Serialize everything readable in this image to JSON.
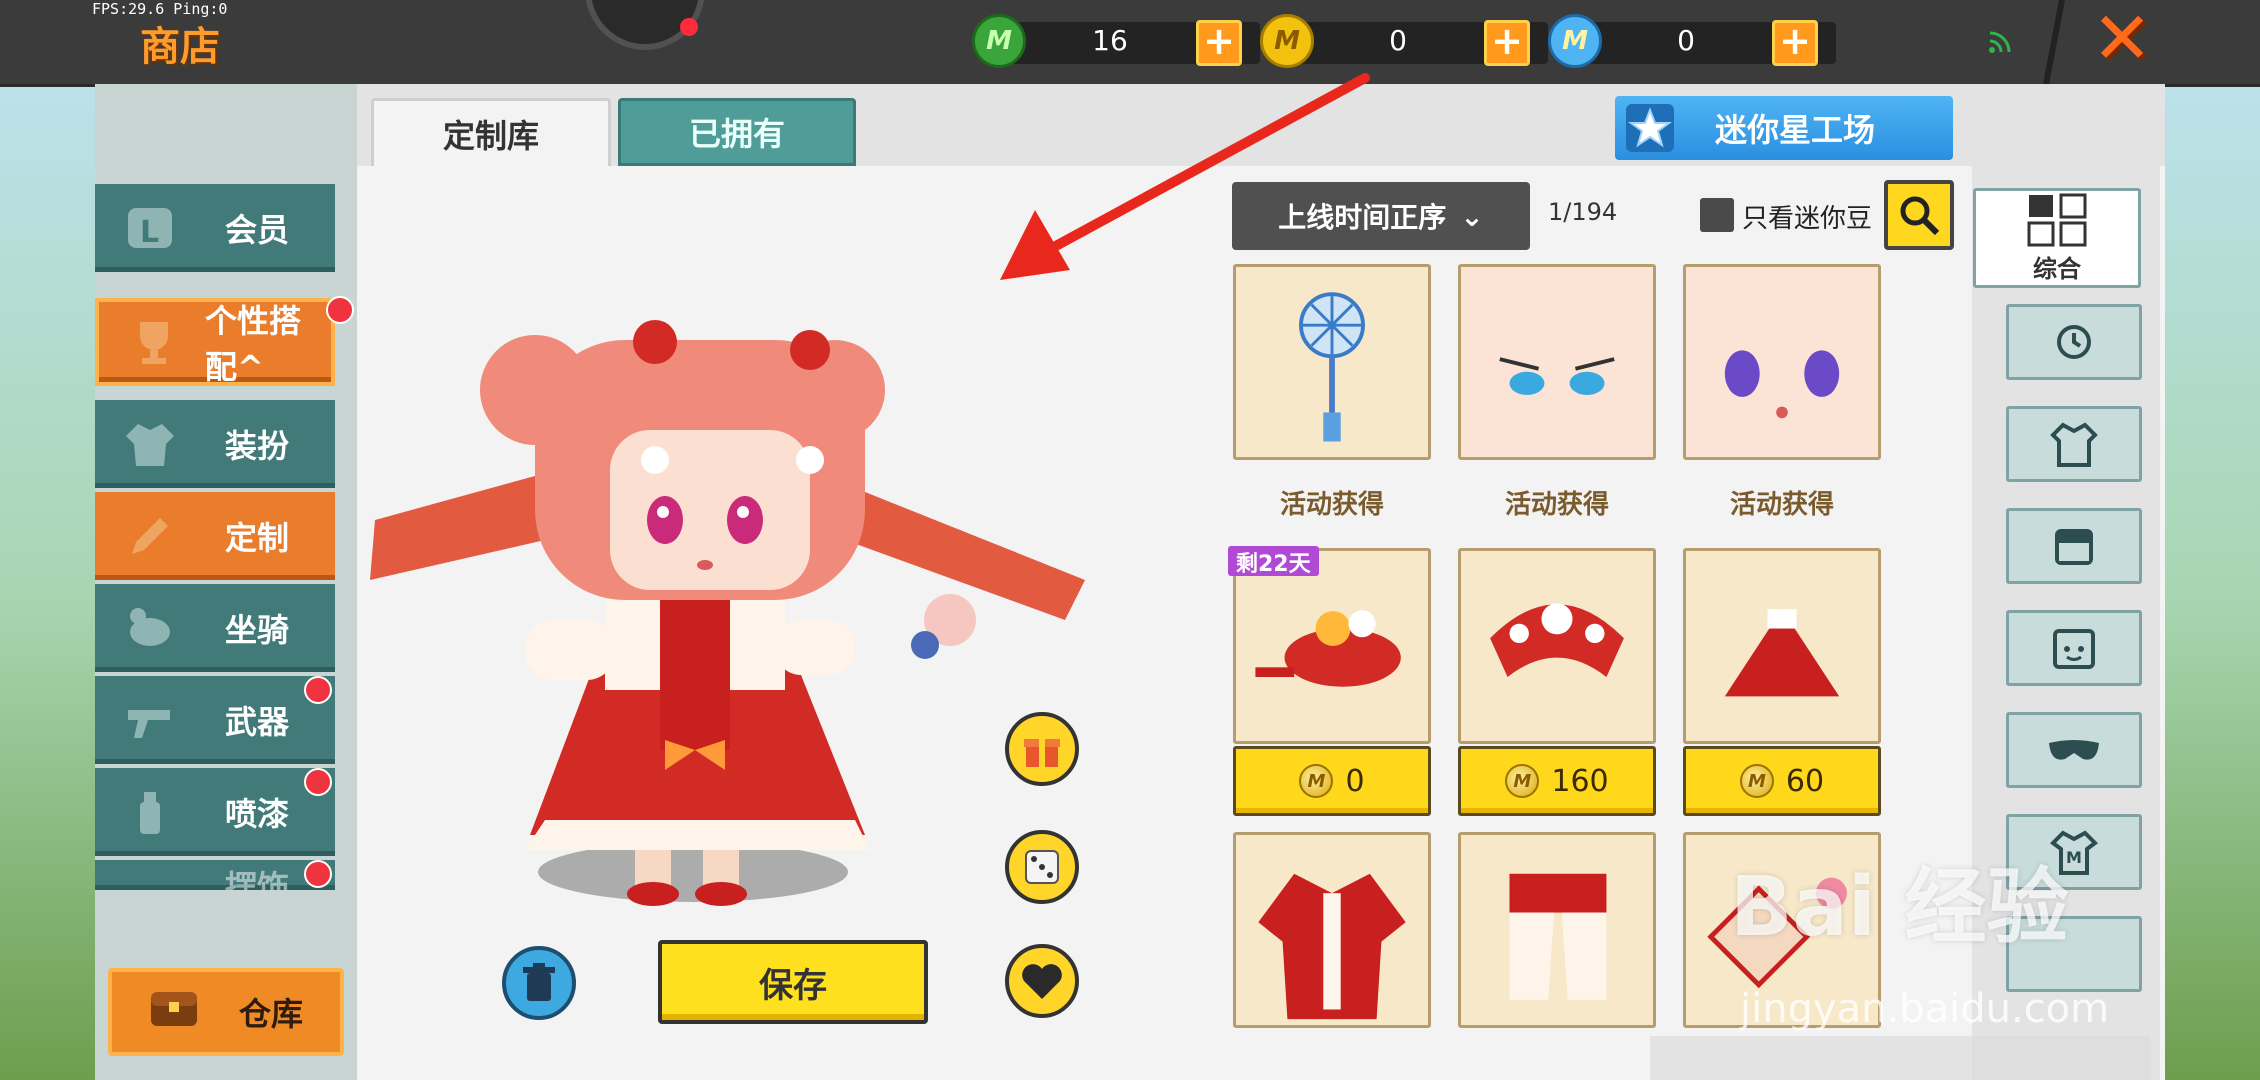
{
  "status": {
    "fps": "FPS:29.6  Ping:0"
  },
  "header": {
    "title": "商店",
    "currencies": [
      {
        "icon": "green-gem-icon",
        "value": "16"
      },
      {
        "icon": "gold-coin-icon",
        "value": "0"
      },
      {
        "icon": "blue-coin-icon",
        "value": "0"
      }
    ]
  },
  "tabs": [
    "定制库",
    "已拥有"
  ],
  "workshop_button": "迷你星工场",
  "sidebar": {
    "items": [
      {
        "label": "会员",
        "icon": "member-icon",
        "style": "teal",
        "dot": false
      },
      {
        "label": "个性搭配",
        "icon": "trophy-icon",
        "style": "orange",
        "dot": true
      },
      {
        "label": "装扮",
        "icon": "shirt-icon",
        "style": "teal",
        "dot": false
      },
      {
        "label": "定制",
        "icon": "pencil-icon",
        "style": "orange",
        "dot": false
      },
      {
        "label": "坐骑",
        "icon": "mount-icon",
        "style": "teal",
        "dot": false
      },
      {
        "label": "武器",
        "icon": "gun-icon",
        "style": "teal",
        "dot": true
      },
      {
        "label": "喷漆",
        "icon": "spray-icon",
        "style": "teal",
        "dot": true
      },
      {
        "label": "摆饰",
        "icon": "decoration-icon",
        "style": "teal",
        "dot": true
      }
    ],
    "warehouse": "仓库"
  },
  "actions": {
    "save": "保存"
  },
  "toolbar": {
    "sort": "上线时间正序",
    "page": "1/194",
    "filter_label": "只看迷你豆"
  },
  "items_row1": [
    "活动获得",
    "活动获得",
    "活动获得"
  ],
  "items_row2": [
    {
      "price": "0",
      "badge": "剩22天"
    },
    {
      "price": "160"
    },
    {
      "price": "60"
    }
  ],
  "categories": {
    "all": "综合"
  },
  "watermark": {
    "main": "Bai 经验",
    "sub": "jingyan.baidu.com"
  },
  "colors": {
    "accent_orange": "#e97d2c",
    "teal": "#427a7a",
    "yellow": "#ffd81c"
  }
}
